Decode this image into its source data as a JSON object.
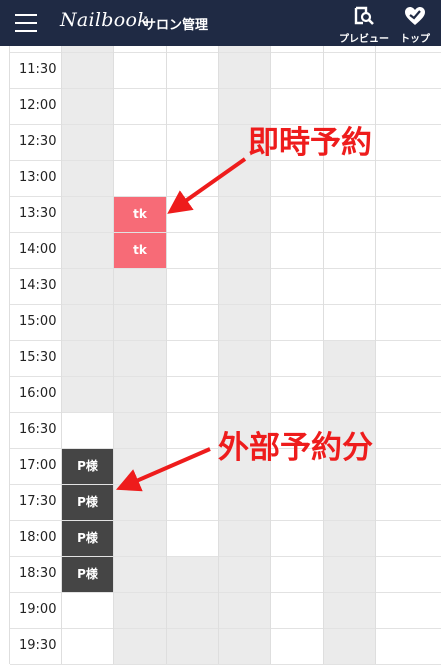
{
  "header": {
    "logo_text": "Nailbook",
    "subtitle": "サロン管理",
    "preview_label": "プレビュー",
    "top_label": "トップ",
    "icons": {
      "menu": "hamburger-icon",
      "preview": "preview-icon",
      "top": "heart-check-icon"
    },
    "background": "#1f2a44"
  },
  "time_slots": [
    "11:30",
    "12:00",
    "12:30",
    "13:00",
    "13:30",
    "14:00",
    "14:30",
    "15:00",
    "15:30",
    "16:00",
    "16:30",
    "17:00",
    "17:30",
    "18:00",
    "18:30",
    "19:00",
    "19:30"
  ],
  "column_count": 7,
  "unavailable": {
    "0": [
      "11:30",
      "12:00",
      "12:30",
      "13:00",
      "13:30",
      "14:00",
      "14:30",
      "15:00",
      "15:30",
      "16:00"
    ],
    "1": [
      "14:30",
      "15:00",
      "15:30",
      "16:00",
      "16:30",
      "17:00",
      "17:30",
      "18:00",
      "18:30",
      "19:00",
      "19:30"
    ],
    "3": [
      "11:30",
      "12:00",
      "12:30",
      "13:00",
      "13:30",
      "14:00",
      "14:30",
      "15:00",
      "15:30",
      "16:00",
      "16:30",
      "17:00",
      "17:30",
      "18:00"
    ],
    "2": [
      "18:30",
      "19:00",
      "19:30"
    ],
    "3b": [
      "18:30",
      "19:00",
      "19:30"
    ],
    "5": [
      "15:30",
      "16:00",
      "16:30",
      "17:00",
      "17:30",
      "18:00",
      "18:30",
      "19:00",
      "19:30"
    ]
  },
  "reservations": [
    {
      "column": 1,
      "time": "13:30",
      "label": "tk",
      "type": "instant",
      "color": "#f76b77"
    },
    {
      "column": 1,
      "time": "14:00",
      "label": "tk",
      "type": "instant",
      "color": "#f76b77"
    },
    {
      "column": 0,
      "time": "17:00",
      "label": "P様",
      "type": "external",
      "color": "#454545"
    },
    {
      "column": 0,
      "time": "17:30",
      "label": "P様",
      "type": "external",
      "color": "#454545"
    },
    {
      "column": 0,
      "time": "18:00",
      "label": "P様",
      "type": "external",
      "color": "#454545"
    },
    {
      "column": 0,
      "time": "18:30",
      "label": "P様",
      "type": "external",
      "color": "#454545"
    }
  ],
  "annotations": {
    "instant": "即時予約",
    "external": "外部予約分"
  },
  "colors": {
    "unavailable": "#ebebeb",
    "annotation": "#ee1c1c"
  }
}
